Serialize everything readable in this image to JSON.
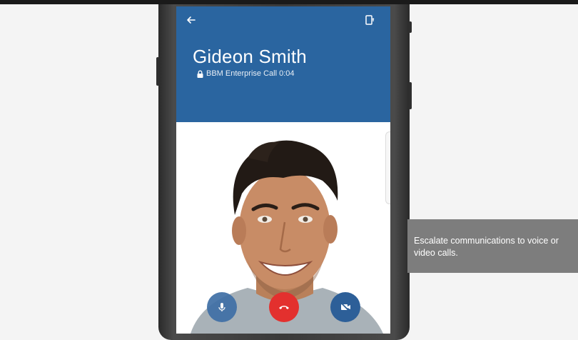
{
  "call": {
    "caller_name": "Gideon Smith",
    "status": "BBM Enterprise Call 0:04"
  },
  "icons": {
    "back": "arrow-left-icon",
    "rotate": "switch-device-icon",
    "lock": "lock-icon",
    "mic": "microphone-icon",
    "end_call": "end-call-icon",
    "video_off": "video-off-icon"
  },
  "caption": {
    "text": "Escalate communications to voice or video calls."
  },
  "colors": {
    "header": "#2a65a0",
    "end_call": "#e3302e",
    "control": "#2d5f98",
    "caption_bg": "#7d7d7d"
  }
}
